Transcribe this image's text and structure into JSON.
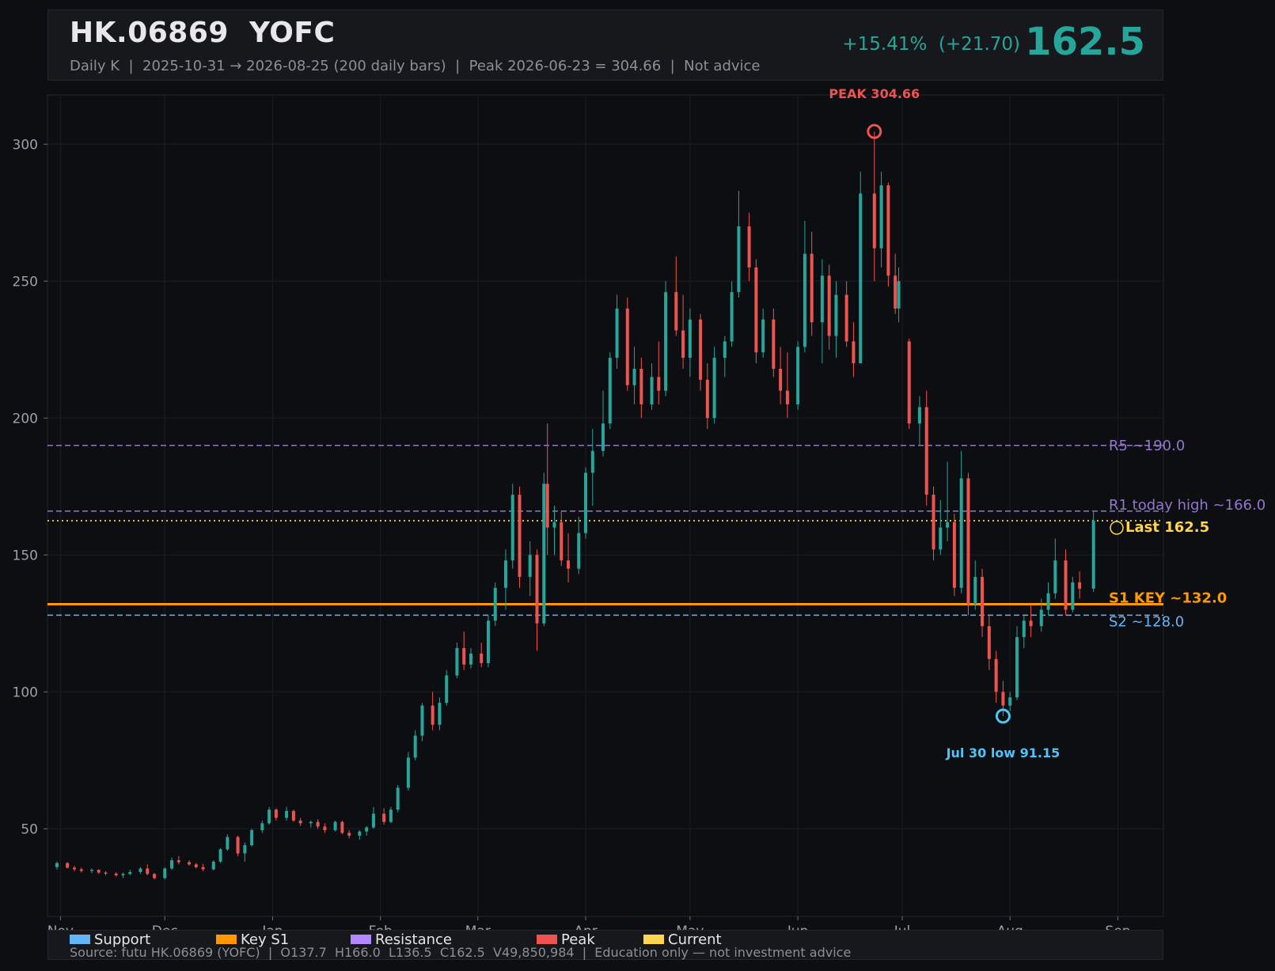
{
  "header": {
    "title": "HK.06869  YOFC",
    "subtitle": "Daily K  |  2025-10-31 → 2026-08-25 (200 daily bars)  |  Peak 2026-06-23 = 304.66  |  Not advice",
    "change": "+15.41%  (+21.70)",
    "price": "162.5"
  },
  "legend": {
    "items": [
      {
        "label": "Support",
        "color": "#64b5f6"
      },
      {
        "label": "Key S1",
        "color": "#ff9800"
      },
      {
        "label": "Resistance",
        "color": "#b388ff"
      },
      {
        "label": "Peak",
        "color": "#ef5350"
      },
      {
        "label": "Current",
        "color": "#ffd54f"
      }
    ]
  },
  "footer": {
    "source": "Source: futu HK.06869 (YOFC)  |  O137.7  H166.0  L136.5  C162.5  V49,850,984  |  Education only — not investment advice"
  },
  "chart_data": {
    "type": "candlestick",
    "x_range": [
      "2025-10-31",
      "2026-09-10"
    ],
    "ylim": [
      18,
      318
    ],
    "yticks": [
      50,
      100,
      150,
      200,
      250,
      300
    ],
    "xticks": [
      {
        "date": "2025-11-01",
        "label": "Nov"
      },
      {
        "date": "2025-12-01",
        "label": "Dec"
      },
      {
        "date": "2026-01-01",
        "label": "Jan"
      },
      {
        "date": "2026-02-01",
        "label": "Feb"
      },
      {
        "date": "2026-03-01",
        "label": "Mar"
      },
      {
        "date": "2026-04-01",
        "label": "Apr"
      },
      {
        "date": "2026-05-01",
        "label": "May"
      },
      {
        "date": "2026-06-01",
        "label": "Jun"
      },
      {
        "date": "2026-07-01",
        "label": "Jul"
      },
      {
        "date": "2026-08-01",
        "label": "Aug"
      },
      {
        "date": "2026-09-01",
        "label": "Sep"
      }
    ],
    "grid": true,
    "up_color": "#26a69a",
    "down_color": "#ef5350",
    "levels": [
      {
        "name": "R5",
        "label": "R5 ~190.0",
        "value": 190.0,
        "color": "#9575cd",
        "style": "dashed",
        "kind": "resistance"
      },
      {
        "name": "R1",
        "label": "R1 today high ~166.0",
        "value": 166.0,
        "color": "#9575cd",
        "style": "dashed",
        "kind": "resistance"
      },
      {
        "name": "Last",
        "label": "Last 162.5",
        "value": 162.5,
        "color": "#ffd54f",
        "style": "dotted",
        "kind": "current"
      },
      {
        "name": "S1",
        "label": "S1 KEY ~132.0",
        "value": 132.0,
        "color": "#ff9800",
        "style": "solid",
        "kind": "key"
      },
      {
        "name": "S2",
        "label": "S2 ~128.0",
        "value": 128.0,
        "color": "#64b5f6",
        "style": "dashed",
        "kind": "support"
      }
    ],
    "annotations": [
      {
        "label": "PEAK 304.66",
        "date": "2026-06-23",
        "value": 304.66,
        "color": "#ef5350",
        "position": "above"
      },
      {
        "label": "Jul 30 low 91.15",
        "date": "2026-07-30",
        "value": 91.15,
        "color": "#4fc3f7",
        "position": "below"
      }
    ],
    "candles": [
      [
        "2025-10-31",
        36.0,
        38.0,
        35.0,
        37.5
      ],
      [
        "2025-11-03",
        37.5,
        37.8,
        35.5,
        35.8
      ],
      [
        "2025-11-05",
        35.8,
        36.5,
        34.5,
        35.2
      ],
      [
        "2025-11-07",
        35.2,
        35.8,
        34.0,
        34.6
      ],
      [
        "2025-11-10",
        34.6,
        35.5,
        33.8,
        35.0
      ],
      [
        "2025-11-12",
        35.0,
        35.2,
        33.5,
        34.0
      ],
      [
        "2025-11-14",
        34.0,
        34.5,
        33.0,
        33.6
      ],
      [
        "2025-11-17",
        33.6,
        34.2,
        32.5,
        33.0
      ],
      [
        "2025-11-19",
        33.0,
        34.0,
        32.0,
        33.5
      ],
      [
        "2025-11-21",
        33.5,
        35.0,
        33.0,
        34.2
      ],
      [
        "2025-11-24",
        34.2,
        36.0,
        33.5,
        35.5
      ],
      [
        "2025-11-26",
        35.5,
        37.0,
        33.0,
        33.5
      ],
      [
        "2025-11-28",
        33.5,
        33.8,
        31.5,
        32.0
      ],
      [
        "2025-12-01",
        32.0,
        36.0,
        31.5,
        35.5
      ],
      [
        "2025-12-03",
        35.5,
        39.5,
        35.0,
        38.5
      ],
      [
        "2025-12-05",
        38.5,
        40.0,
        37.0,
        37.8
      ],
      [
        "2025-12-08",
        37.8,
        38.5,
        36.5,
        37.0
      ],
      [
        "2025-12-10",
        37.0,
        37.5,
        35.5,
        36.0
      ],
      [
        "2025-12-12",
        36.0,
        37.2,
        34.5,
        35.2
      ],
      [
        "2025-12-15",
        35.2,
        38.5,
        34.8,
        38.0
      ],
      [
        "2025-12-17",
        38.0,
        43.0,
        37.5,
        42.5
      ],
      [
        "2025-12-19",
        42.5,
        48.0,
        42.0,
        47.0
      ],
      [
        "2025-12-22",
        47.0,
        47.5,
        40.0,
        41.0
      ],
      [
        "2025-12-24",
        41.0,
        45.0,
        38.0,
        44.0
      ],
      [
        "2025-12-26",
        44.0,
        50.0,
        43.5,
        49.5
      ],
      [
        "2025-12-29",
        49.5,
        53.0,
        48.5,
        52.0
      ],
      [
        "2025-12-31",
        52.0,
        58.0,
        51.5,
        57.0
      ],
      [
        "2026-01-02",
        57.0,
        57.5,
        53.0,
        54.0
      ],
      [
        "2026-01-05",
        54.0,
        58.0,
        53.0,
        56.5
      ],
      [
        "2026-01-07",
        56.5,
        57.0,
        52.5,
        53.0
      ],
      [
        "2026-01-09",
        53.0,
        54.0,
        51.0,
        52.0
      ],
      [
        "2026-01-12",
        52.0,
        53.0,
        50.5,
        52.5
      ],
      [
        "2026-01-14",
        52.5,
        53.5,
        50.0,
        50.8
      ],
      [
        "2026-01-16",
        50.8,
        52.0,
        48.5,
        49.5
      ],
      [
        "2026-01-19",
        49.5,
        53.0,
        49.0,
        52.5
      ],
      [
        "2026-01-21",
        52.5,
        53.0,
        48.0,
        48.5
      ],
      [
        "2026-01-23",
        48.5,
        49.5,
        46.5,
        47.5
      ],
      [
        "2026-01-26",
        47.5,
        49.5,
        46.0,
        49.0
      ],
      [
        "2026-01-28",
        49.0,
        51.0,
        47.5,
        50.5
      ],
      [
        "2026-01-30",
        50.5,
        58.0,
        50.0,
        55.5
      ],
      [
        "2026-02-02",
        55.5,
        57.5,
        51.5,
        52.5
      ],
      [
        "2026-02-04",
        52.5,
        58.0,
        52.0,
        57.0
      ],
      [
        "2026-02-06",
        57.0,
        66.0,
        56.0,
        65.0
      ],
      [
        "2026-02-09",
        65.0,
        78.0,
        64.0,
        76.0
      ],
      [
        "2026-02-11",
        76.0,
        86.0,
        75.0,
        84.0
      ],
      [
        "2026-02-13",
        84.0,
        96.0,
        82.0,
        95.0
      ],
      [
        "2026-02-16",
        95.0,
        100.0,
        86.0,
        88.0
      ],
      [
        "2026-02-18",
        88.0,
        98.0,
        86.0,
        96.0
      ],
      [
        "2026-02-20",
        96.0,
        108.0,
        95.0,
        106.0
      ],
      [
        "2026-02-23",
        106.0,
        118.0,
        105.0,
        116.0
      ],
      [
        "2026-02-25",
        116.0,
        122.0,
        108.0,
        110.0
      ],
      [
        "2026-02-27",
        110.0,
        116.0,
        108.5,
        114.0
      ],
      [
        "2026-03-02",
        114.0,
        118.0,
        109.0,
        110.5
      ],
      [
        "2026-03-04",
        110.5,
        128.0,
        109.0,
        126.0
      ],
      [
        "2026-03-06",
        126.0,
        140.0,
        124.0,
        138.0
      ],
      [
        "2026-03-09",
        138.0,
        152.0,
        130.0,
        148.0
      ],
      [
        "2026-03-11",
        148.0,
        176.0,
        145.0,
        172.0
      ],
      [
        "2026-03-13",
        172.0,
        175.0,
        138.0,
        142.0
      ],
      [
        "2026-03-16",
        142.0,
        155.0,
        135.0,
        150.0
      ],
      [
        "2026-03-18",
        150.0,
        152.0,
        115.0,
        125.0
      ],
      [
        "2026-03-20",
        125.0,
        180.0,
        124.0,
        176.0
      ],
      [
        "2026-03-21",
        176.0,
        198.0,
        150.0,
        160.0
      ],
      [
        "2026-03-23",
        160.0,
        168.0,
        150.0,
        162.0
      ],
      [
        "2026-03-25",
        162.0,
        166.0,
        146.0,
        148.0
      ],
      [
        "2026-03-27",
        148.0,
        158.0,
        140.0,
        145.0
      ],
      [
        "2026-03-30",
        145.0,
        164.0,
        143.0,
        158.0
      ],
      [
        "2026-04-01",
        158.0,
        182.0,
        156.0,
        180.0
      ],
      [
        "2026-04-03",
        180.0,
        196.0,
        168.0,
        188.0
      ],
      [
        "2026-04-06",
        188.0,
        210.0,
        186.0,
        198.0
      ],
      [
        "2026-04-08",
        198.0,
        224.0,
        196.0,
        222.0
      ],
      [
        "2026-04-10",
        222.0,
        245.0,
        218.0,
        240.0
      ],
      [
        "2026-04-13",
        240.0,
        244.0,
        210.0,
        212.0
      ],
      [
        "2026-04-15",
        212.0,
        226.0,
        205.0,
        218.0
      ],
      [
        "2026-04-17",
        218.0,
        222.0,
        200.0,
        205.0
      ],
      [
        "2026-04-20",
        205.0,
        220.0,
        203.0,
        215.0
      ],
      [
        "2026-04-22",
        215.0,
        228.0,
        205.0,
        210.0
      ],
      [
        "2026-04-24",
        210.0,
        250.0,
        208.0,
        246.0
      ],
      [
        "2026-04-27",
        246.0,
        259.0,
        230.0,
        232.0
      ],
      [
        "2026-04-29",
        232.0,
        245.0,
        218.0,
        222.0
      ],
      [
        "2026-05-01",
        222.0,
        240.0,
        215.0,
        236.0
      ],
      [
        "2026-05-04",
        236.0,
        238.0,
        210.0,
        214.0
      ],
      [
        "2026-05-06",
        214.0,
        220.0,
        196.0,
        200.0
      ],
      [
        "2026-05-08",
        200.0,
        226.0,
        198.0,
        222.0
      ],
      [
        "2026-05-11",
        222.0,
        230.0,
        215.0,
        228.0
      ],
      [
        "2026-05-13",
        228.0,
        250.0,
        226.0,
        246.0
      ],
      [
        "2026-05-15",
        246.0,
        283.0,
        244.0,
        270.0
      ],
      [
        "2026-05-18",
        270.0,
        275.0,
        250.0,
        255.0
      ],
      [
        "2026-05-20",
        255.0,
        258.0,
        220.0,
        224.0
      ],
      [
        "2026-05-22",
        224.0,
        240.0,
        222.0,
        236.0
      ],
      [
        "2026-05-25",
        236.0,
        240.0,
        215.0,
        218.0
      ],
      [
        "2026-05-27",
        218.0,
        226.0,
        205.0,
        210.0
      ],
      [
        "2026-05-29",
        210.0,
        224.0,
        200.0,
        205.0
      ],
      [
        "2026-06-01",
        205.0,
        228.0,
        203.0,
        226.0
      ],
      [
        "2026-06-03",
        226.0,
        272.0,
        224.0,
        260.0
      ],
      [
        "2026-06-05",
        260.0,
        268.0,
        230.0,
        235.0
      ],
      [
        "2026-06-08",
        235.0,
        258.0,
        220.0,
        252.0
      ],
      [
        "2026-06-10",
        252.0,
        256.0,
        225.0,
        230.0
      ],
      [
        "2026-06-12",
        230.0,
        250.0,
        222.0,
        245.0
      ],
      [
        "2026-06-15",
        245.0,
        250.0,
        226.0,
        228.0
      ],
      [
        "2026-06-17",
        228.0,
        235.0,
        215.0,
        220.0
      ],
      [
        "2026-06-19",
        220.0,
        290.0,
        234.0,
        282.0
      ],
      [
        "2026-06-23",
        282.0,
        304.66,
        250.0,
        262.0
      ],
      [
        "2026-06-25",
        262.0,
        290.0,
        255.0,
        285.0
      ],
      [
        "2026-06-27",
        285.0,
        286.0,
        248.0,
        252.0
      ],
      [
        "2026-06-29",
        252.0,
        260.0,
        238.0,
        240.0
      ],
      [
        "2026-06-30",
        240.0,
        255.0,
        235.0,
        250.0
      ],
      [
        "2026-07-03",
        228.0,
        229.0,
        196.0,
        198.0
      ],
      [
        "2026-07-06",
        198.0,
        208.0,
        190.0,
        204.0
      ],
      [
        "2026-07-08",
        204.0,
        210.0,
        168.0,
        172.0
      ],
      [
        "2026-07-10",
        172.0,
        175.0,
        148.0,
        152.0
      ],
      [
        "2026-07-12",
        152.0,
        170.0,
        150.0,
        160.0
      ],
      [
        "2026-07-14",
        160.0,
        184.0,
        155.0,
        162.0
      ],
      [
        "2026-07-16",
        162.0,
        165.0,
        135.0,
        138.0
      ],
      [
        "2026-07-18",
        138.0,
        188.0,
        136.0,
        178.0
      ],
      [
        "2026-07-20",
        178.0,
        180.0,
        128.0,
        132.0
      ],
      [
        "2026-07-22",
        132.0,
        148.0,
        130.0,
        142.0
      ],
      [
        "2026-07-24",
        142.0,
        145.0,
        120.0,
        124.0
      ],
      [
        "2026-07-26",
        124.0,
        128.0,
        108.0,
        112.0
      ],
      [
        "2026-07-28",
        112.0,
        115.0,
        96.0,
        100.0
      ],
      [
        "2026-07-30",
        100.0,
        104.0,
        91.15,
        95.0
      ],
      [
        "2026-08-01",
        95.0,
        100.0,
        93.0,
        98.0
      ],
      [
        "2026-08-03",
        98.0,
        124.0,
        97.0,
        120.0
      ],
      [
        "2026-08-05",
        120.0,
        128.0,
        116.0,
        126.0
      ],
      [
        "2026-08-07",
        126.0,
        132.0,
        120.0,
        124.0
      ],
      [
        "2026-08-10",
        124.0,
        134.0,
        122.0,
        130.0
      ],
      [
        "2026-08-12",
        130.0,
        140.0,
        128.0,
        136.0
      ],
      [
        "2026-08-14",
        136.0,
        156.0,
        134.0,
        148.0
      ],
      [
        "2026-08-17",
        148.0,
        152.0,
        128.0,
        130.0
      ],
      [
        "2026-08-19",
        130.0,
        142.0,
        129.0,
        140.0
      ],
      [
        "2026-08-21",
        140.0,
        144.0,
        134.0,
        137.7
      ],
      [
        "2026-08-25",
        137.7,
        166.0,
        136.5,
        162.5
      ]
    ]
  }
}
